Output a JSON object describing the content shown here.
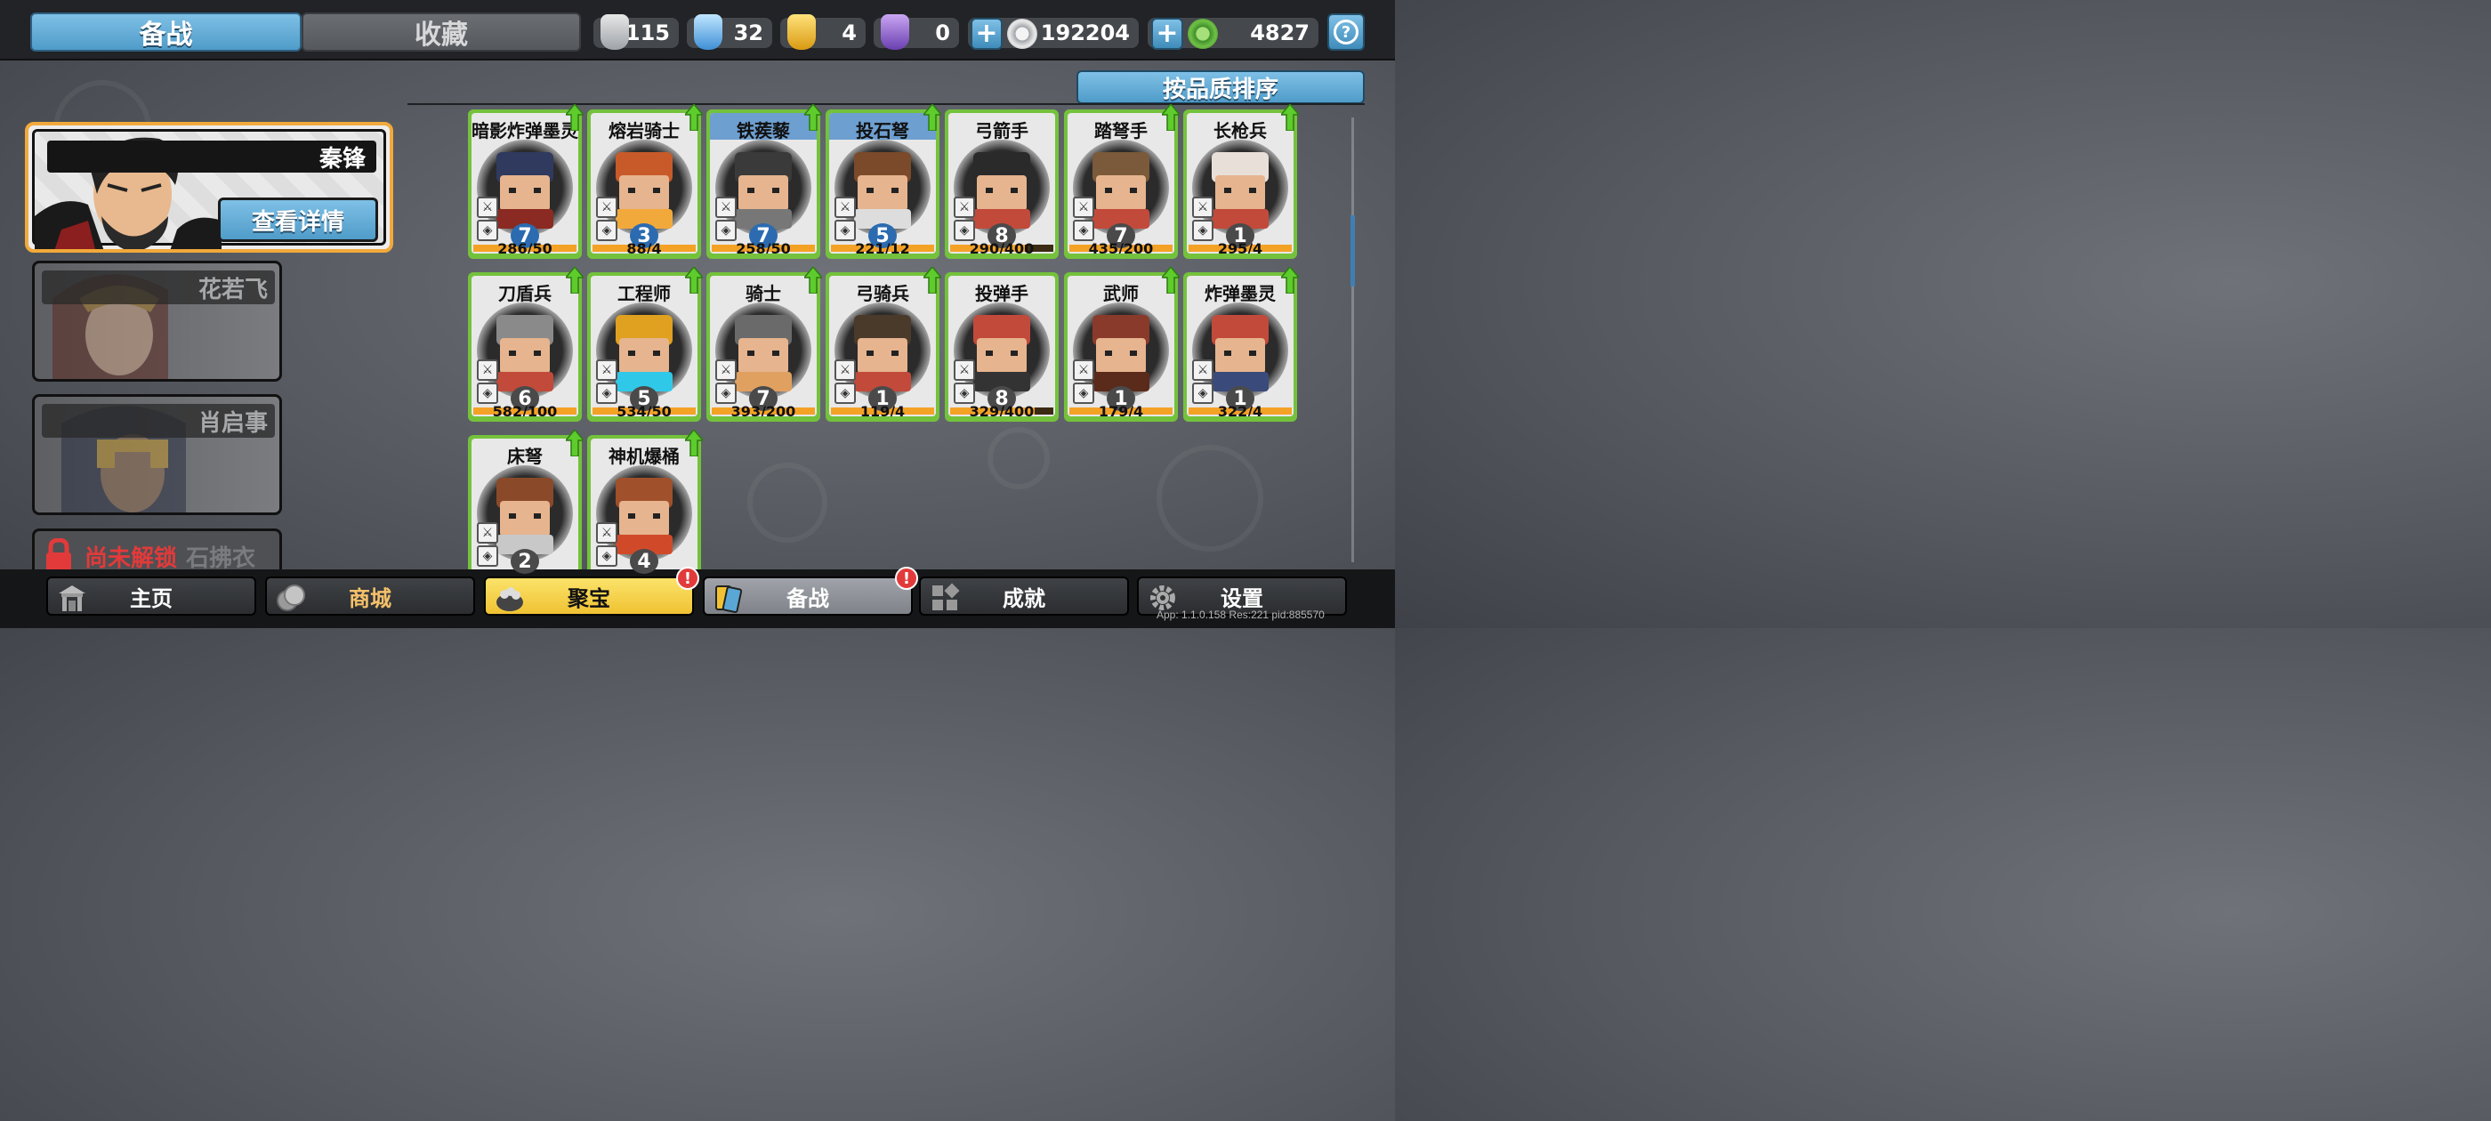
{
  "top_tabs": {
    "active": "备战",
    "inactive": "收藏"
  },
  "resources": [
    {
      "icon": "silver-shard-icon",
      "value": "115"
    },
    {
      "icon": "blue-crystal-icon",
      "value": "32"
    },
    {
      "icon": "gold-shield-icon",
      "value": "4"
    },
    {
      "icon": "purple-gem-icon",
      "value": "0"
    }
  ],
  "currency": {
    "silver_coin": "192204",
    "jade_coin": "4827"
  },
  "help_label": "?",
  "sort_button": "按品质排序",
  "selected_hero": {
    "name": "秦锋",
    "detail_button": "查看详情"
  },
  "heroes": [
    {
      "name": "花若飞"
    },
    {
      "name": "肖启事"
    }
  ],
  "locked_hero": {
    "lock_label": "尚未解锁",
    "name": "石拂衣"
  },
  "units": [
    {
      "name": "暗影炸弹墨灵",
      "level": "7",
      "count": "286/50",
      "progress": 1.0,
      "upgrade": true,
      "blue_top": false,
      "badge_blue": true
    },
    {
      "name": "熔岩骑士",
      "level": "3",
      "count": "88/4",
      "progress": 1.0,
      "upgrade": true,
      "blue_top": false,
      "badge_blue": true
    },
    {
      "name": "铁蒺藜",
      "level": "7",
      "count": "258/50",
      "progress": 1.0,
      "upgrade": true,
      "blue_top": true,
      "badge_blue": true
    },
    {
      "name": "投石弩",
      "level": "5",
      "count": "221/12",
      "progress": 1.0,
      "upgrade": true,
      "blue_top": true,
      "badge_blue": true
    },
    {
      "name": "弓箭手",
      "level": "8",
      "count": "290/400",
      "progress": 0.72,
      "upgrade": false,
      "blue_top": false,
      "badge_blue": false
    },
    {
      "name": "踏弩手",
      "level": "7",
      "count": "435/200",
      "progress": 1.0,
      "upgrade": true,
      "blue_top": false,
      "badge_blue": false
    },
    {
      "name": "长枪兵",
      "level": "1",
      "count": "295/4",
      "progress": 1.0,
      "upgrade": true,
      "blue_top": false,
      "badge_blue": false
    },
    {
      "name": "刀盾兵",
      "level": "6",
      "count": "582/100",
      "progress": 1.0,
      "upgrade": true,
      "blue_top": false,
      "badge_blue": false
    },
    {
      "name": "工程师",
      "level": "5",
      "count": "534/50",
      "progress": 1.0,
      "upgrade": true,
      "blue_top": false,
      "badge_blue": false
    },
    {
      "name": "骑士",
      "level": "7",
      "count": "393/200",
      "progress": 1.0,
      "upgrade": true,
      "blue_top": false,
      "badge_blue": false
    },
    {
      "name": "弓骑兵",
      "level": "1",
      "count": "119/4",
      "progress": 1.0,
      "upgrade": true,
      "blue_top": false,
      "badge_blue": false
    },
    {
      "name": "投弹手",
      "level": "8",
      "count": "329/400",
      "progress": 0.82,
      "upgrade": false,
      "blue_top": false,
      "badge_blue": false
    },
    {
      "name": "武师",
      "level": "1",
      "count": "179/4",
      "progress": 1.0,
      "upgrade": true,
      "blue_top": false,
      "badge_blue": false
    },
    {
      "name": "炸弹墨灵",
      "level": "1",
      "count": "322/4",
      "progress": 1.0,
      "upgrade": true,
      "blue_top": false,
      "badge_blue": false
    },
    {
      "name": "床弩",
      "level": "2",
      "count": "",
      "progress": 1.0,
      "upgrade": true,
      "blue_top": false,
      "badge_blue": false
    },
    {
      "name": "神机爆桶",
      "level": "4",
      "count": "",
      "progress": 1.0,
      "upgrade": true,
      "blue_top": false,
      "badge_blue": false
    }
  ],
  "bottom_nav": [
    {
      "label": "主页",
      "icon": "home-gate-icon"
    },
    {
      "label": "商城",
      "icon": "coins-icon"
    },
    {
      "label": "聚宝",
      "icon": "treasure-bowl-icon",
      "alert": "!"
    },
    {
      "label": "备战",
      "icon": "cards-icon",
      "alert": "!"
    },
    {
      "label": "成就",
      "icon": "achievement-grid-icon"
    },
    {
      "label": "设置",
      "icon": "gear-icon"
    }
  ],
  "version_text": "App: 1.1.0.158 Res:221 pid:885570",
  "colors": {
    "accent_blue": "#5aa7d6",
    "selected_border": "#f2a93b",
    "card_green": "#74c23c",
    "progress_orange": "#f4a226",
    "alert_red": "#e23a3a",
    "active_nav": "#f5d24c"
  }
}
